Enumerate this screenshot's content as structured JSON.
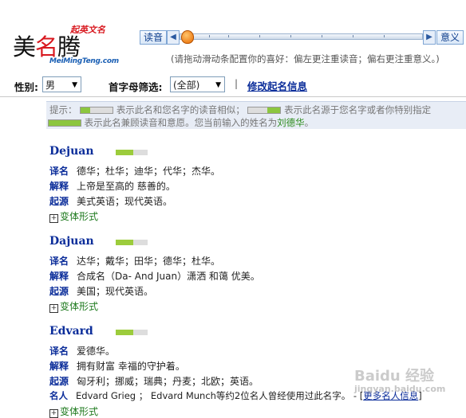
{
  "brand": {
    "logo_text_1": "美",
    "logo_text_2": "名",
    "logo_text_3": "腾",
    "tagline": "起英文名",
    "url": "MeiMingTeng.com"
  },
  "slider": {
    "left_label": "读音",
    "right_label": "意义",
    "left_arrow": "◀",
    "right_arrow": "▶",
    "position": 0.03,
    "hint": "(请拖动滑动条配置你的喜好：偏左更注重读音；偏右更注重意义。)"
  },
  "filters": {
    "gender_label": "性别:",
    "gender_value": "男",
    "initial_label": "首字母筛选:",
    "initial_value": "(全部)",
    "separator": "|",
    "edit_link": "修改起名信息"
  },
  "tips": {
    "prefix": "提示：",
    "line1_a": "表示此名和您名字的读音相似；",
    "line1_b": "表示此名源于您名字或者你特别指定",
    "line2_a": "表示此名兼顾读音和意愿。您当前输入的姓名为",
    "input_name": "刘德华",
    "line2_end": "。"
  },
  "entries": [
    {
      "name": "Dejuan",
      "score": 0.55,
      "rows": [
        {
          "k": "译名",
          "v": "德华；杜华；迪华；代华；杰华。"
        },
        {
          "k": "解释",
          "v": "上帝是至高的 慈善的。"
        },
        {
          "k": "起源",
          "v": "美式英语；现代英语。"
        }
      ],
      "variant": "变体形式",
      "variant_icon": "+"
    },
    {
      "name": "Dajuan",
      "score": 0.55,
      "rows": [
        {
          "k": "译名",
          "v": "达华；戴华；田华；德华；杜华。"
        },
        {
          "k": "解释",
          "v": "合成名（Da- And Juan）潇洒 和蔼 优美。"
        },
        {
          "k": "起源",
          "v": "美国；现代英语。"
        }
      ],
      "variant": "变体形式",
      "variant_icon": "+"
    },
    {
      "name": "Edvard",
      "score": 0.55,
      "rows": [
        {
          "k": "译名",
          "v": "爱德华。"
        },
        {
          "k": "解释",
          "v": "拥有财富 幸福的守护着。"
        },
        {
          "k": "起源",
          "v": "匈牙利；挪威；瑞典；丹麦；北欧；英语。"
        }
      ],
      "famous": {
        "k": "名人",
        "v": "Edvard Grieg ； Edvard Munch等约2位名人曾经使用过此名字。 - [",
        "link": "更多名人信息",
        "end": "]"
      },
      "variant": "变体形式",
      "variant_icon": "+"
    }
  ],
  "watermark": {
    "text": "Baidu 经验",
    "sub": "jingyan.baidu.com"
  },
  "colors": {
    "link": "#0b2d9a",
    "bar_fill": "#9ccc3c",
    "highlight": "#2a8a1a",
    "accent": "#d8181f"
  }
}
